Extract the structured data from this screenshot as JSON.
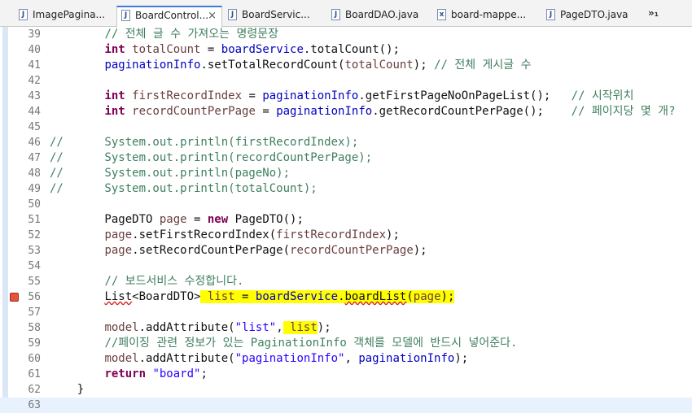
{
  "tabs": [
    {
      "label": "ImagePagina...",
      "icon": "java-file-icon",
      "active": false
    },
    {
      "label": "BoardControl...",
      "icon": "java-file-icon",
      "active": true
    },
    {
      "label": "BoardServic...",
      "icon": "java-file-icon",
      "active": false
    },
    {
      "label": "BoardDAO.java",
      "icon": "java-file-icon",
      "active": false
    },
    {
      "label": "board-mappe...",
      "icon": "xml-file-icon",
      "active": false
    },
    {
      "label": "PageDTO.java",
      "icon": "java-file-icon",
      "active": false
    }
  ],
  "tab_close": "×",
  "overflow_label": "»₁",
  "lines": [
    {
      "n": "39",
      "t": "        // 전체 글 수 가져오는 명령문장"
    },
    {
      "n": "40",
      "t": "        int totalCount = boardService.totalCount();"
    },
    {
      "n": "41",
      "t": "        paginationInfo.setTotalRecordCount(totalCount); // 전체 게시글 수"
    },
    {
      "n": "42",
      "t": ""
    },
    {
      "n": "43",
      "t": "        int firstRecordIndex = paginationInfo.getFirstPageNoOnPageList();   // 시작위치"
    },
    {
      "n": "44",
      "t": "        int recordCountPerPage = paginationInfo.getRecordCountPerPage();    // 페이지당 몇 개?"
    },
    {
      "n": "45",
      "t": ""
    },
    {
      "n": "46",
      "t": "//      System.out.println(firstRecordIndex);"
    },
    {
      "n": "47",
      "t": "//      System.out.println(recordCountPerPage);"
    },
    {
      "n": "48",
      "t": "//      System.out.println(pageNo);"
    },
    {
      "n": "49",
      "t": "//      System.out.println(totalCount);"
    },
    {
      "n": "50",
      "t": ""
    },
    {
      "n": "51",
      "t": "        PageDTO page = new PageDTO();"
    },
    {
      "n": "52",
      "t": "        page.setFirstRecordIndex(firstRecordIndex);"
    },
    {
      "n": "53",
      "t": "        page.setRecordCountPerPage(recordCountPerPage);"
    },
    {
      "n": "54",
      "t": ""
    },
    {
      "n": "55",
      "t": "        // 보드서비스 수정합니다."
    },
    {
      "n": "56",
      "t": "        List<BoardDTO> list = boardService.boardList(page);"
    },
    {
      "n": "57",
      "t": ""
    },
    {
      "n": "58",
      "t": "        model.addAttribute(\"list\", list);"
    },
    {
      "n": "59",
      "t": "        //페이징 관련 정보가 있는 PaginationInfo 객체를 모델에 반드시 넣어준다."
    },
    {
      "n": "60",
      "t": "        model.addAttribute(\"paginationInfo\", paginationInfo);"
    },
    {
      "n": "61",
      "t": "        return \"board\";"
    },
    {
      "n": "62",
      "t": "    }"
    },
    {
      "n": "63",
      "t": ""
    }
  ]
}
